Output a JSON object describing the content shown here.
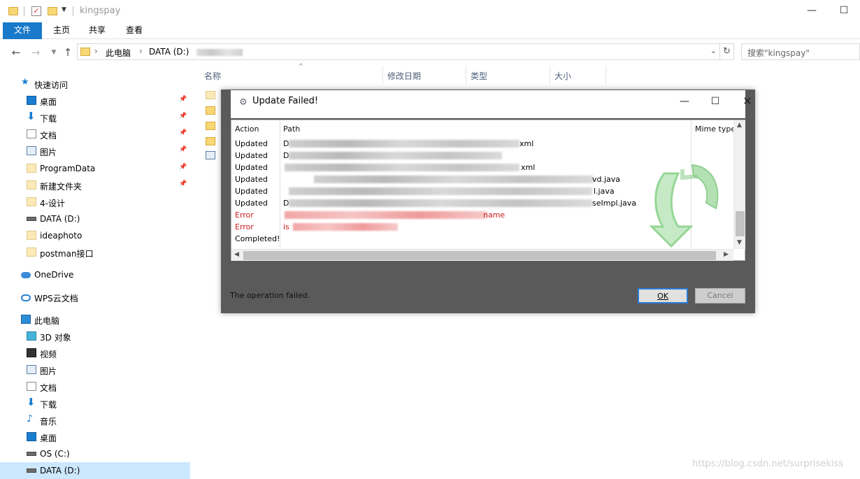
{
  "window": {
    "title": "kingspay",
    "controls": {
      "minimize": "—",
      "maximize": "☐"
    }
  },
  "ribbon": {
    "tabs": [
      "文件",
      "主页",
      "共享",
      "查看"
    ]
  },
  "address": {
    "segments": [
      "此电脑",
      "DATA (D:)"
    ],
    "search_placeholder": "搜索\"kingspay\""
  },
  "sidebar": {
    "items": [
      {
        "label": "快速访问",
        "icon": "star-icon",
        "pinned": false
      },
      {
        "label": "桌面",
        "icon": "desktop-icon",
        "pinned": true
      },
      {
        "label": "下载",
        "icon": "download-icon",
        "pinned": true
      },
      {
        "label": "文档",
        "icon": "document-icon",
        "pinned": true
      },
      {
        "label": "图片",
        "icon": "picture-icon",
        "pinned": true
      },
      {
        "label": "ProgramData",
        "icon": "folder-icon",
        "pinned": true
      },
      {
        "label": "新建文件夹",
        "icon": "folder-icon",
        "pinned": true
      },
      {
        "label": "4-设计",
        "icon": "folder-icon",
        "pinned": false
      },
      {
        "label": "DATA (D:)",
        "icon": "drive-icon",
        "pinned": false
      },
      {
        "label": "ideaphoto",
        "icon": "folder-icon",
        "pinned": false
      },
      {
        "label": "postman接口",
        "icon": "folder-icon",
        "pinned": false
      },
      {
        "label": "OneDrive",
        "icon": "onedrive-icon",
        "pinned": false
      },
      {
        "label": "WPS云文档",
        "icon": "wps-cloud-icon",
        "pinned": false
      },
      {
        "label": "此电脑",
        "icon": "computer-icon",
        "pinned": false
      },
      {
        "label": "3D 对象",
        "icon": "cube-icon",
        "pinned": false
      },
      {
        "label": "视频",
        "icon": "video-icon",
        "pinned": false
      },
      {
        "label": "图片",
        "icon": "picture-icon",
        "pinned": false
      },
      {
        "label": "文档",
        "icon": "document-icon",
        "pinned": false
      },
      {
        "label": "下载",
        "icon": "download-icon",
        "pinned": false
      },
      {
        "label": "音乐",
        "icon": "music-icon",
        "pinned": false
      },
      {
        "label": "桌面",
        "icon": "desktop-icon",
        "pinned": false
      },
      {
        "label": "OS (C:)",
        "icon": "drive-icon",
        "pinned": false
      },
      {
        "label": "DATA (D:)",
        "icon": "drive-icon",
        "pinned": false,
        "selected": true
      }
    ]
  },
  "file_list": {
    "columns": [
      "名称",
      "修改日期",
      "类型",
      "大小"
    ]
  },
  "dialog": {
    "title": "Update Failed!",
    "columns": {
      "action": "Action",
      "path": "Path",
      "mime": "Mime type"
    },
    "rows": [
      {
        "action": "Updated",
        "path_start": "D",
        "path_end": "xml",
        "error": false
      },
      {
        "action": "Updated",
        "path_start": "D",
        "path_end": "",
        "error": false
      },
      {
        "action": "Updated",
        "path_start": "",
        "path_end": "xml",
        "error": false
      },
      {
        "action": "Updated",
        "path_start": "",
        "path_end": "vd.java",
        "error": false
      },
      {
        "action": "Updated",
        "path_start": "",
        "path_end": "l.java",
        "error": false
      },
      {
        "action": "Updated",
        "path_start": "D",
        "path_end": "seImpl.java",
        "error": false
      },
      {
        "action": "Error",
        "path_start": "",
        "path_end": "name",
        "error": true
      },
      {
        "action": "Error",
        "path_start": "is",
        "path_end": "",
        "error": true
      },
      {
        "action": "Completed!",
        "path_start": "",
        "path_end": "",
        "error": false
      }
    ],
    "status": "The operation failed.",
    "ok_label": "OK",
    "cancel_label": "Cancel"
  },
  "watermark": "https://blog.csdn.net/surprisekiss",
  "colors": {
    "accent": "#1979ca",
    "error": "#cc1b1b",
    "dialog_frame": "#5a5a5a"
  }
}
